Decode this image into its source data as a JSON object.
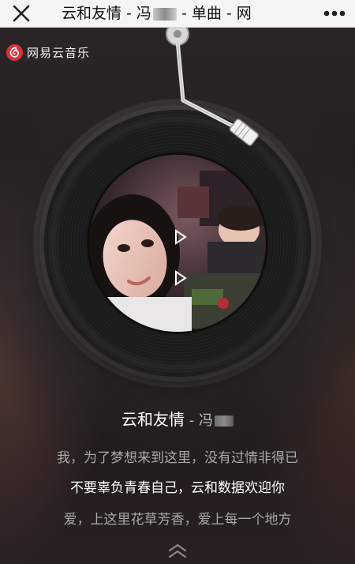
{
  "navbar": {
    "title": "云和友情 - 冯",
    "title_suffix": " - 单曲 - 网"
  },
  "brand": {
    "name": "网易云音乐",
    "logo_color": "#d9333a"
  },
  "song": {
    "title": "云和友情",
    "separator": " - ",
    "artist_visible": "冯"
  },
  "lyrics": [
    {
      "text": "我，为了梦想来到这里，没有过情非得已",
      "current": false
    },
    {
      "text": "不要辜负青春自己，云和数据欢迎你",
      "current": true
    },
    {
      "text": "爱，上这里花草芳香，爱上每一个地方",
      "current": false
    }
  ],
  "icons": {
    "close": "close-icon",
    "more": "more-icon",
    "logo": "netease-music-logo-icon",
    "expand": "chevron-up-double-icon"
  },
  "colors": {
    "brand_red": "#d9333a",
    "lyric_active": "#ffffff",
    "lyric_inactive": "#a8a8a8"
  }
}
